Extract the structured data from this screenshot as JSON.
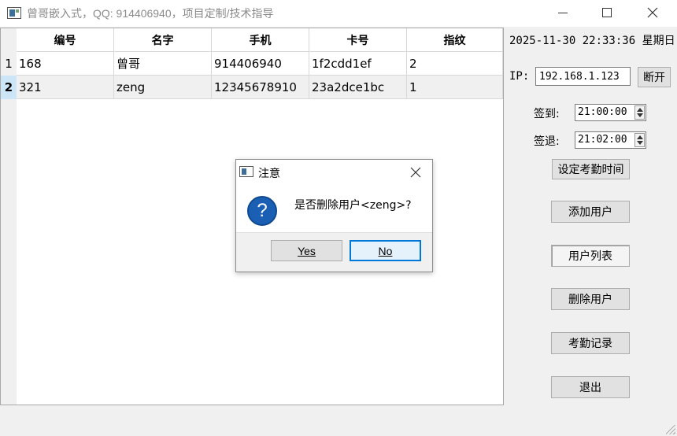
{
  "window": {
    "title": "曾哥嵌入式，QQ: 914406940，项目定制/技术指导"
  },
  "table": {
    "columns": [
      "编号",
      "名字",
      "手机",
      "卡号",
      "指纹"
    ],
    "row_numbers": [
      "1",
      "2"
    ],
    "rows": [
      [
        "168",
        "曾哥",
        "914406940",
        "1f2cdd1ef",
        "2"
      ],
      [
        "321",
        "zeng",
        "12345678910",
        "23a2dce1bc",
        "1"
      ]
    ],
    "selected_row": 2
  },
  "panel": {
    "datetime": "2025-11-30 22:33:36 星期日",
    "ip_label": "IP:",
    "ip_value": "192.168.1.123",
    "disconnect_label": "断开",
    "checkin_label": "签到:",
    "checkin_value": "21:00:00",
    "checkout_label": "签退:",
    "checkout_value": "21:02:00",
    "set_time_label": "设定考勤时间",
    "add_user_label": "添加用户",
    "user_list_label": "用户列表",
    "delete_user_label": "删除用户",
    "attendance_label": "考勤记录",
    "exit_label": "退出"
  },
  "dialog": {
    "title": "注意",
    "message": "是否删除用户<zeng>?",
    "yes_label": "Yes",
    "no_label": "No"
  },
  "icons": {
    "app": "app-window-icon",
    "question": "question-icon",
    "close": "close-icon"
  },
  "colors": {
    "selection": "#cde6f7",
    "dialog_default_border": "#0078d7",
    "question_icon": "#1a5fb4"
  }
}
